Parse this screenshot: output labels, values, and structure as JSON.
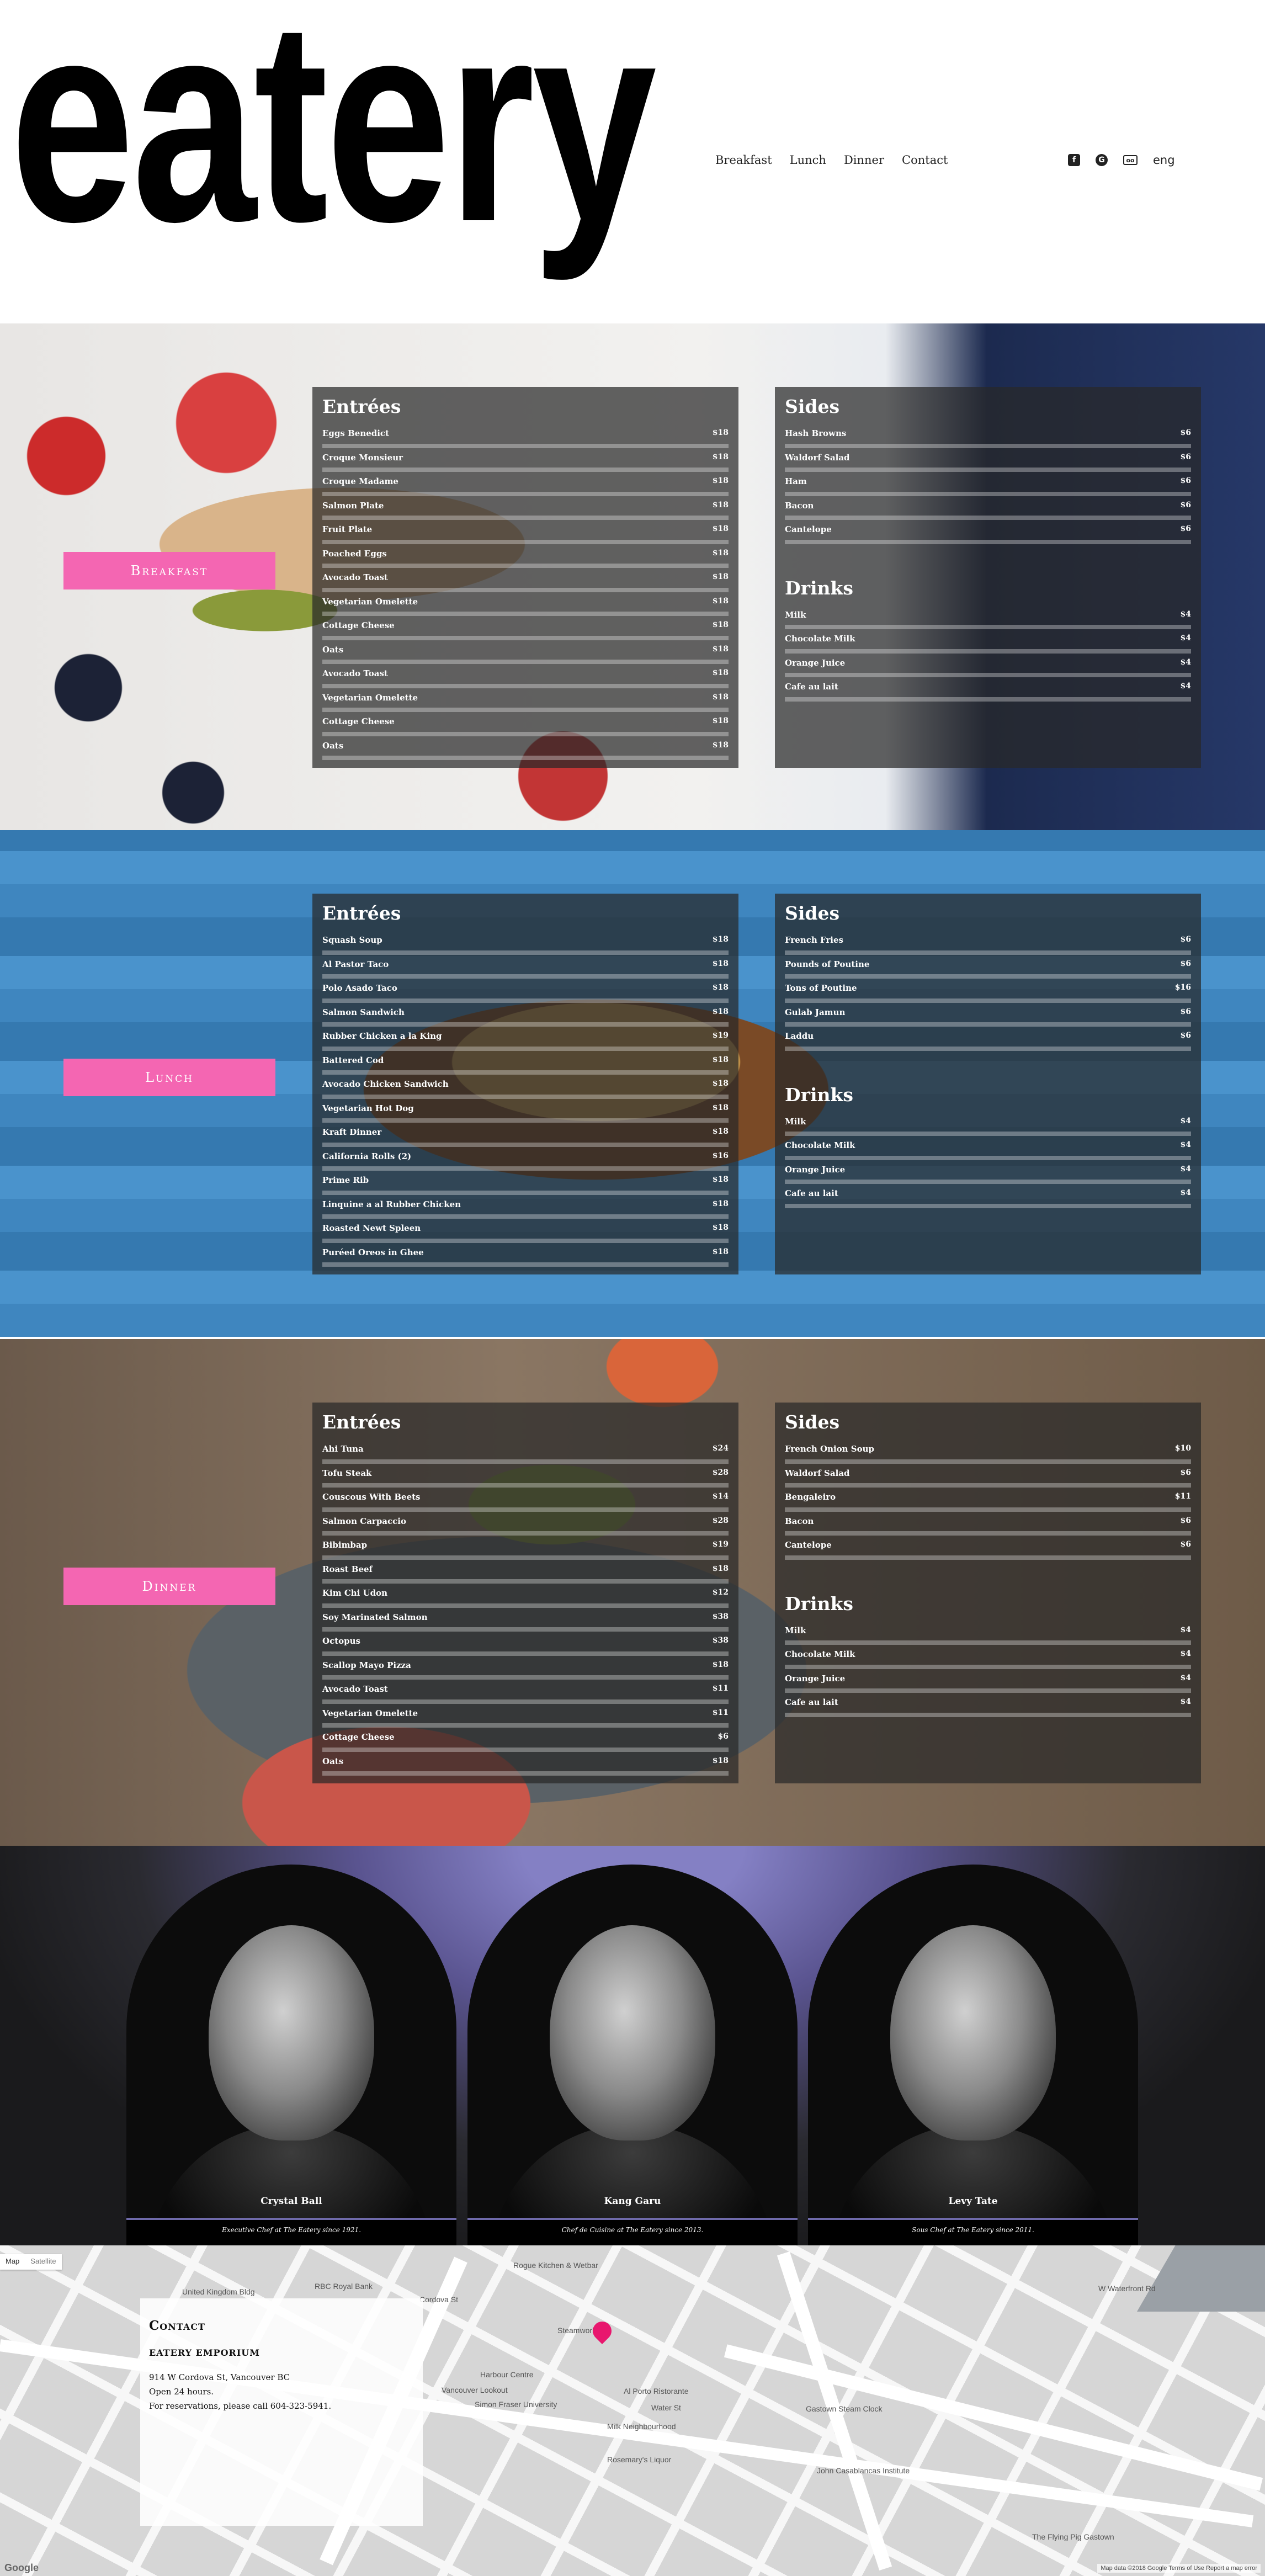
{
  "header": {
    "logo": "eatery",
    "nav": [
      "Breakfast",
      "Lunch",
      "Dinner",
      "Contact"
    ],
    "social_icons": [
      "facebook-icon",
      "google-plus-icon",
      "tripadvisor-icon"
    ],
    "language": "eng"
  },
  "breakfast": {
    "tag": "Breakfast",
    "entrees_title": "Entrées",
    "entrees": [
      {
        "name": "Eggs Benedict",
        "price": "$18"
      },
      {
        "name": "Croque Monsieur",
        "price": "$18"
      },
      {
        "name": "Croque Madame",
        "price": "$18"
      },
      {
        "name": "Salmon Plate",
        "price": "$18"
      },
      {
        "name": "Fruit Plate",
        "price": "$18"
      },
      {
        "name": "Poached Eggs",
        "price": "$18"
      },
      {
        "name": "Avocado Toast",
        "price": "$18"
      },
      {
        "name": "Vegetarian Omelette",
        "price": "$18"
      },
      {
        "name": "Cottage Cheese",
        "price": "$18"
      },
      {
        "name": "Oats",
        "price": "$18"
      },
      {
        "name": "Avocado Toast",
        "price": "$18"
      },
      {
        "name": "Vegetarian Omelette",
        "price": "$18"
      },
      {
        "name": "Cottage Cheese",
        "price": "$18"
      },
      {
        "name": "Oats",
        "price": "$18"
      }
    ],
    "sides_title": "Sides",
    "sides": [
      {
        "name": "Hash Browns",
        "price": "$6"
      },
      {
        "name": "Waldorf Salad",
        "price": "$6"
      },
      {
        "name": "Ham",
        "price": "$6"
      },
      {
        "name": "Bacon",
        "price": "$6"
      },
      {
        "name": "Cantelope",
        "price": "$6"
      }
    ],
    "drinks_title": "Drinks",
    "drinks": [
      {
        "name": "Milk",
        "price": "$4"
      },
      {
        "name": "Chocolate Milk",
        "price": "$4"
      },
      {
        "name": "Orange Juice",
        "price": "$4"
      },
      {
        "name": "Cafe au lait",
        "price": "$4"
      }
    ]
  },
  "lunch": {
    "tag": "Lunch",
    "entrees_title": "Entrées",
    "entrees": [
      {
        "name": "Squash Soup",
        "price": "$18"
      },
      {
        "name": "Al Pastor Taco",
        "price": "$18"
      },
      {
        "name": "Polo Asado Taco",
        "price": "$18"
      },
      {
        "name": "Salmon Sandwich",
        "price": "$18"
      },
      {
        "name": "Rubber Chicken a la King",
        "price": "$19"
      },
      {
        "name": "Battered Cod",
        "price": "$18"
      },
      {
        "name": "Avocado Chicken Sandwich",
        "price": "$18"
      },
      {
        "name": "Vegetarian Hot Dog",
        "price": "$18"
      },
      {
        "name": "Kraft Dinner",
        "price": "$18"
      },
      {
        "name": "California Rolls (2)",
        "price": "$16"
      },
      {
        "name": "Prime Rib",
        "price": "$18"
      },
      {
        "name": "Linquine a al Rubber Chicken",
        "price": "$18"
      },
      {
        "name": "Roasted Newt Spleen",
        "price": "$18"
      },
      {
        "name": "Puréed Oreos in Ghee",
        "price": "$18"
      }
    ],
    "sides_title": "Sides",
    "sides": [
      {
        "name": "French Fries",
        "price": "$6"
      },
      {
        "name": "Pounds of Poutine",
        "price": "$6"
      },
      {
        "name": "Tons of Poutine",
        "price": "$16"
      },
      {
        "name": "Gulab Jamun",
        "price": "$6"
      },
      {
        "name": "Laddu",
        "price": "$6"
      }
    ],
    "drinks_title": "Drinks",
    "drinks": [
      {
        "name": "Milk",
        "price": "$4"
      },
      {
        "name": "Chocolate Milk",
        "price": "$4"
      },
      {
        "name": "Orange Juice",
        "price": "$4"
      },
      {
        "name": "Cafe au lait",
        "price": "$4"
      }
    ]
  },
  "dinner": {
    "tag": "Dinner",
    "entrees_title": "Entrées",
    "entrees": [
      {
        "name": "Ahi Tuna",
        "price": "$24"
      },
      {
        "name": "Tofu Steak",
        "price": "$28"
      },
      {
        "name": "Couscous With Beets",
        "price": "$14"
      },
      {
        "name": "Salmon Carpaccio",
        "price": "$28"
      },
      {
        "name": "Bibimbap",
        "price": "$19"
      },
      {
        "name": "Roast Beef",
        "price": "$18"
      },
      {
        "name": "Kim Chi Udon",
        "price": "$12"
      },
      {
        "name": "Soy Marinated Salmon",
        "price": "$38"
      },
      {
        "name": "Octopus",
        "price": "$38"
      },
      {
        "name": "Scallop Mayo Pizza",
        "price": "$18"
      },
      {
        "name": "Avocado Toast",
        "price": "$11"
      },
      {
        "name": "Vegetarian Omelette",
        "price": "$11"
      },
      {
        "name": "Cottage Cheese",
        "price": "$6"
      },
      {
        "name": "Oats",
        "price": "$18"
      }
    ],
    "sides_title": "Sides",
    "sides": [
      {
        "name": "French Onion Soup",
        "price": "$10"
      },
      {
        "name": "Waldorf Salad",
        "price": "$6"
      },
      {
        "name": "Bengaleiro",
        "price": "$11"
      },
      {
        "name": "Bacon",
        "price": "$6"
      },
      {
        "name": "Cantelope",
        "price": "$6"
      }
    ],
    "drinks_title": "Drinks",
    "drinks": [
      {
        "name": "Milk",
        "price": "$4"
      },
      {
        "name": "Chocolate Milk",
        "price": "$4"
      },
      {
        "name": "Orange Juice",
        "price": "$4"
      },
      {
        "name": "Cafe au lait",
        "price": "$4"
      }
    ]
  },
  "team": [
    {
      "name": "Crystal Ball",
      "desc": "Executive Chef at The Eatery since 1921."
    },
    {
      "name": "Kang Garu",
      "desc": "Chef de Cuisine at The Eatery since 2013."
    },
    {
      "name": "Levy Tate",
      "desc": "Sous Chef at The Eatery since 2011."
    }
  ],
  "map": {
    "type_map": "Map",
    "type_satellite": "Satellite",
    "labels": [
      "Rogue Kitchen & Wetbar",
      "RBC Royal Bank",
      "United Kingdom Bldg",
      "Harbour Centre",
      "Simon Fraser University",
      "Water St",
      "Gastown Steam Clock",
      "Milk Neighbourhood",
      "The Flying Pig Gastown",
      "John Casablancas Institute",
      "Rosemary's Liquor",
      "Al Porto Ristorante",
      "Vancouver Lookout",
      "Cordova St",
      "W Waterfront Rd",
      "Steamworks"
    ],
    "attribution": "Map data ©2018 Google   Terms of Use   Report a map error",
    "google": "Google"
  },
  "contact": {
    "title": "Contact",
    "business": "EATERY EMPORIUM",
    "address": "914 W Cordova St, Vancouver BC",
    "hours": "Open 24 hours.",
    "reservations": "For reservations, please call 604-323-5941."
  }
}
